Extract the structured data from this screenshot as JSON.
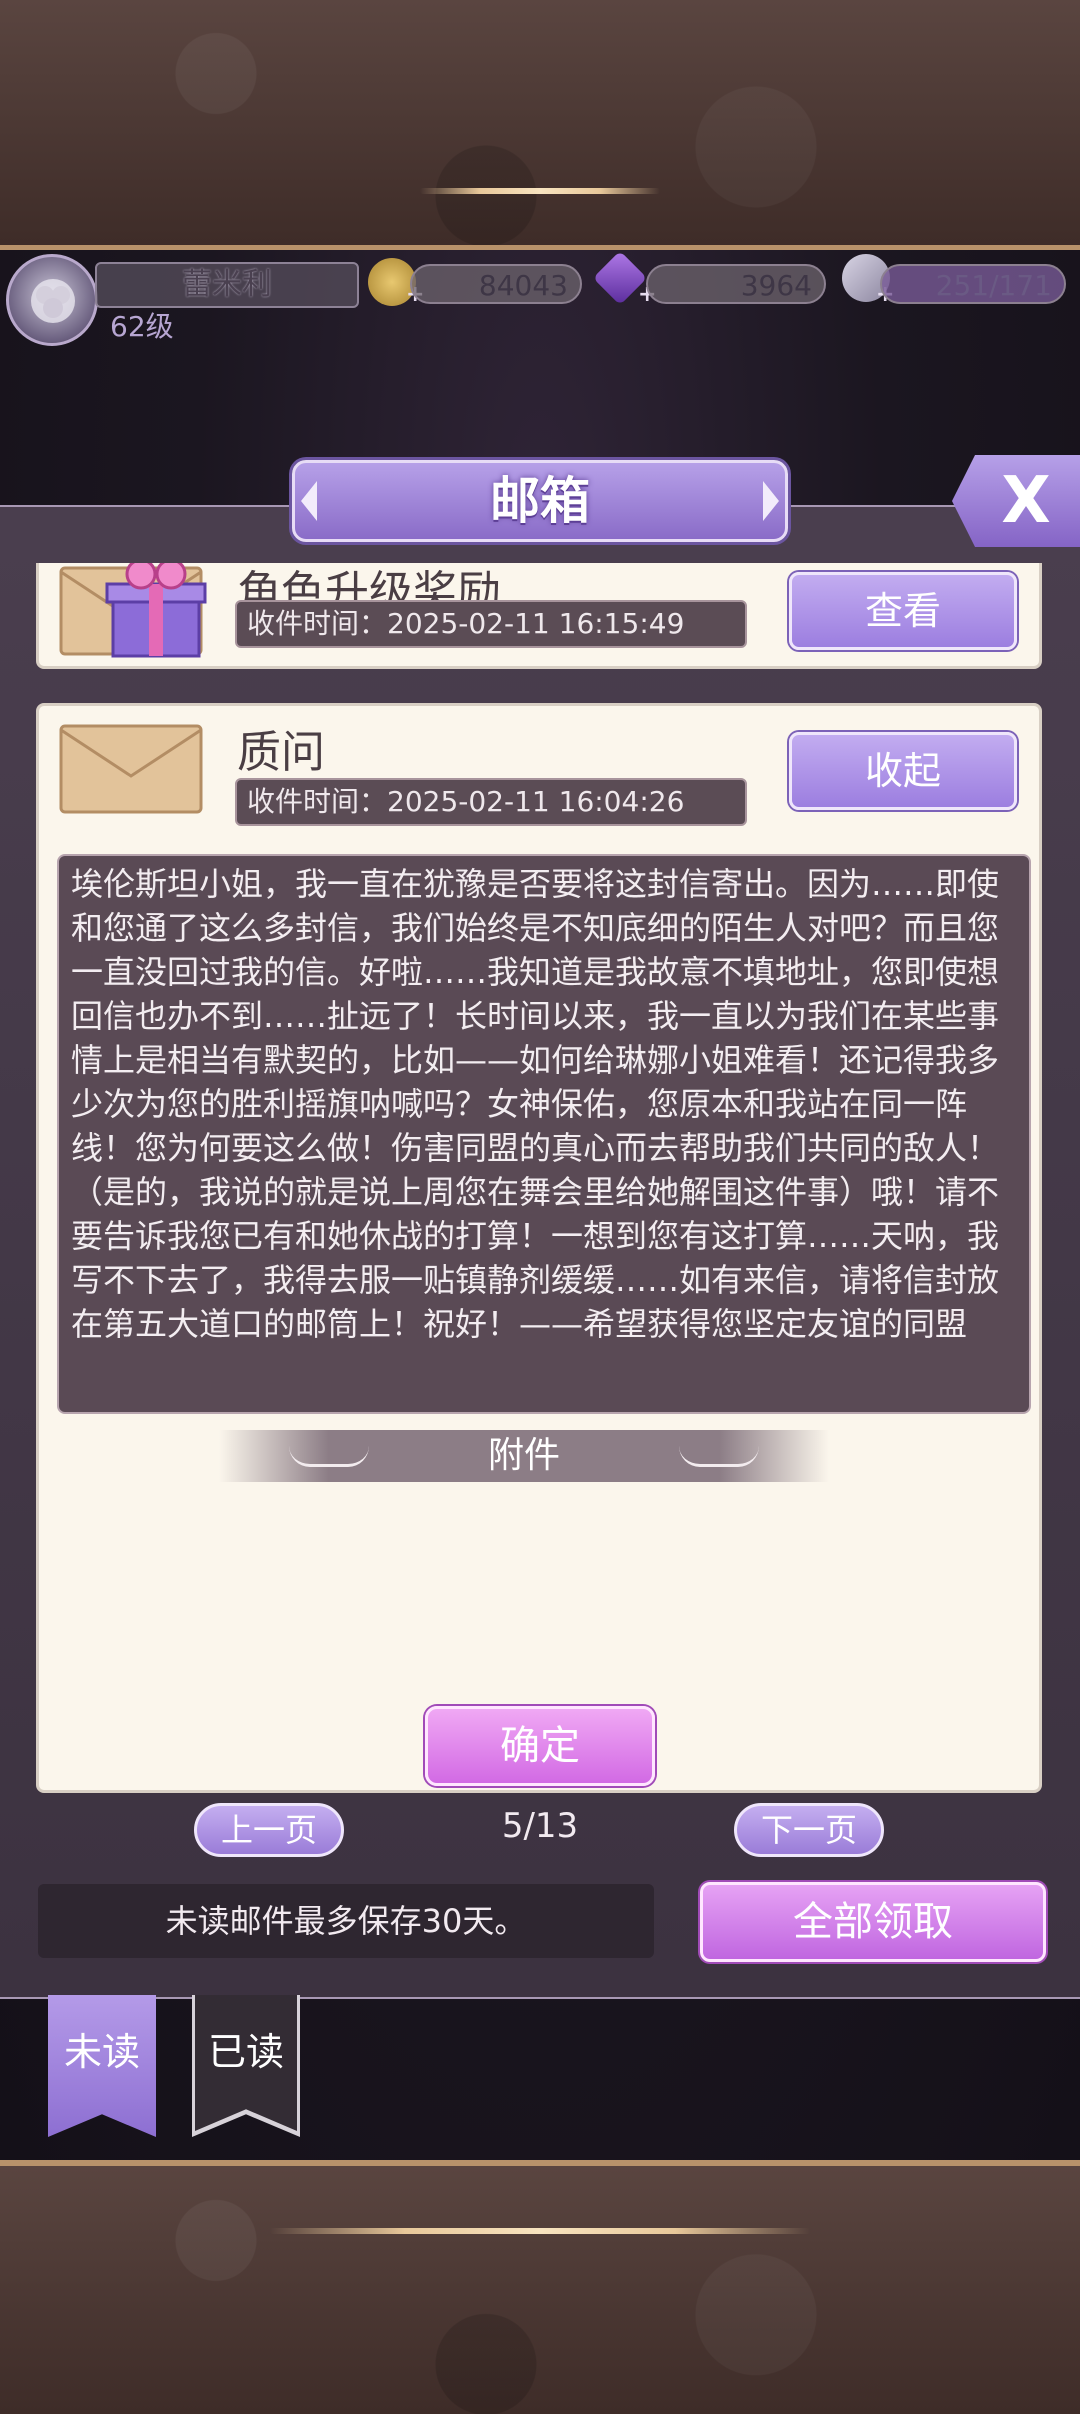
{
  "player": {
    "name": "蕾米利",
    "level": "62级"
  },
  "resources": {
    "gold": "84043",
    "gems": "3964",
    "stamina": "251/171"
  },
  "modal": {
    "title": "邮箱",
    "close_label": "X"
  },
  "mails": [
    {
      "title": "角色升级奖励",
      "time": "收件时间：2025-02-11 16:15:49",
      "button": "查看"
    },
    {
      "title": "质问",
      "time": "收件时间：2025-02-11 16:04:26",
      "button": "收起",
      "body": "埃伦斯坦小姐，我一直在犹豫是否要将这封信寄出。因为……即使和您通了这么多封信，我们始终是不知底细的陌生人对吧？而且您一直没回过我的信。好啦……我知道是我故意不填地址，您即使想回信也办不到……扯远了！长时间以来，我一直以为我们在某些事情上是相当有默契的，比如——如何给琳娜小姐难看！还记得我多少次为您的胜利摇旗呐喊吗？女神保佑，您原本和我站在同一阵线！您为何要这么做！伤害同盟的真心而去帮助我们共同的敌人！（是的，我说的就是说上周您在舞会里给她解围这件事）哦！请不要告诉我您已有和她休战的打算！一想到您有这打算……天呐，我写不下去了，我得去服一贴镇静剂缓缓……如有来信，请将信封放在第五大道口的邮筒上！祝好！——希望获得您坚定友谊的同盟",
      "attachment_label": "附件",
      "confirm_label": "确定"
    }
  ],
  "pagination": {
    "prev": "上一页",
    "current": "5/13",
    "next": "下一页"
  },
  "footer": {
    "notice": "未读邮件最多保存30天。",
    "claim_all": "全部领取"
  },
  "tabs": {
    "unread": "未读",
    "read": "已读"
  }
}
